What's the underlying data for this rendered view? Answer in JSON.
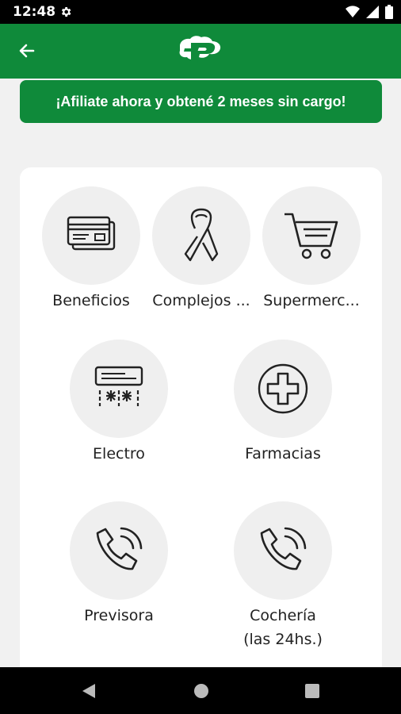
{
  "status_bar": {
    "time": "12:48"
  },
  "promo": {
    "text": "¡Afiliate ahora y obtené 2 meses sin cargo!"
  },
  "tiles": [
    {
      "label": "Beneficios",
      "icon": "credit-cards-icon"
    },
    {
      "label": "Complejos ...",
      "icon": "ribbon-icon"
    },
    {
      "label": "Supermerc...",
      "icon": "shopping-cart-icon"
    },
    {
      "label": "Electro",
      "icon": "air-conditioner-icon"
    },
    {
      "label": "Farmacias",
      "icon": "pharmacy-cross-icon"
    },
    {
      "label": "Previsora",
      "icon": "phone-call-icon"
    },
    {
      "label": "Cochería",
      "label2": "(las 24hs.)",
      "icon": "phone-call-icon"
    }
  ],
  "colors": {
    "brand_green": "#0f8a3a",
    "background": "#f1f1f1",
    "tile_circle": "#efefef"
  }
}
